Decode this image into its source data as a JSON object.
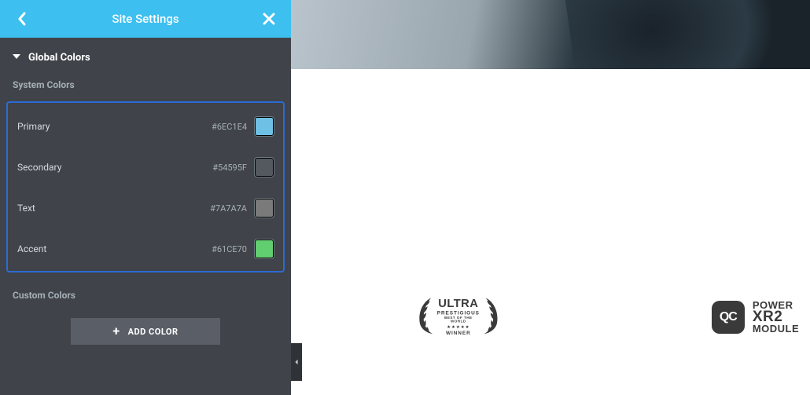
{
  "header": {
    "title": "Site Settings"
  },
  "section": {
    "title": "Global Colors",
    "system_label": "System Colors",
    "colors": [
      {
        "label": "Primary",
        "hex": "#6EC1E4",
        "swatch": "#6EC1E4"
      },
      {
        "label": "Secondary",
        "hex": "#54595F",
        "swatch": "#54595F"
      },
      {
        "label": "Text",
        "hex": "#7A7A7A",
        "swatch": "#7A7A7A"
      },
      {
        "label": "Accent",
        "hex": "#61CE70",
        "swatch": "#61CE70"
      }
    ],
    "custom_label": "Custom Colors",
    "add_button": "ADD COLOR"
  },
  "preview": {
    "laurel": {
      "line1": "ULTRA",
      "line2": "PRESTIGIOUS",
      "line3": "BEST OF THE WORLD",
      "stars": "★★★★★",
      "line4": "WINNER"
    },
    "qc": {
      "icon_text": "QC",
      "line1": "POWER",
      "line2": "XR2",
      "line3": "MODULE"
    }
  }
}
